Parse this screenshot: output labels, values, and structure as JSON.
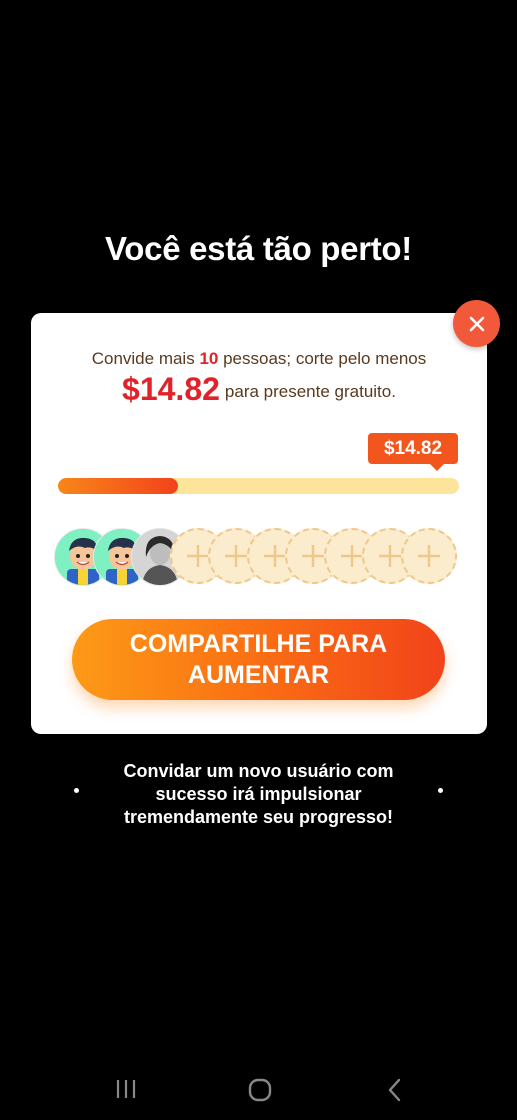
{
  "headline": "Você está tão perto!",
  "card": {
    "invite_prefix": "Convide mais ",
    "invite_count": "10",
    "invite_suffix": " pessoas; corte pelo menos",
    "amount": "$14.82",
    "amount_suffix": "para presente gratuito.",
    "badge_amount": "$14.82",
    "progress_fraction": 0.3,
    "share_button": "COMPARTILHE PARA AUMENTAR"
  },
  "avatars": [
    {
      "type": "cartoon",
      "icon": "cartoon-avatar-icon"
    },
    {
      "type": "cartoon",
      "icon": "cartoon-avatar-icon"
    },
    {
      "type": "photo",
      "icon": "user-photo-avatar"
    },
    {
      "type": "empty",
      "icon": "plus-icon"
    },
    {
      "type": "empty",
      "icon": "plus-icon"
    },
    {
      "type": "empty",
      "icon": "plus-icon"
    },
    {
      "type": "empty",
      "icon": "plus-icon"
    },
    {
      "type": "empty",
      "icon": "plus-icon"
    },
    {
      "type": "empty",
      "icon": "plus-icon"
    },
    {
      "type": "empty",
      "icon": "plus-icon"
    }
  ],
  "note": "Convidar um novo usuário com sucesso irá impulsionar tremendamente seu progresso!",
  "colors": {
    "accent": "#f2561d",
    "highlight": "#e0222a",
    "track": "#fde49b",
    "close": "#f2583a"
  },
  "navbar": {
    "icons": [
      "recent-apps-icon",
      "home-icon",
      "back-icon"
    ]
  }
}
